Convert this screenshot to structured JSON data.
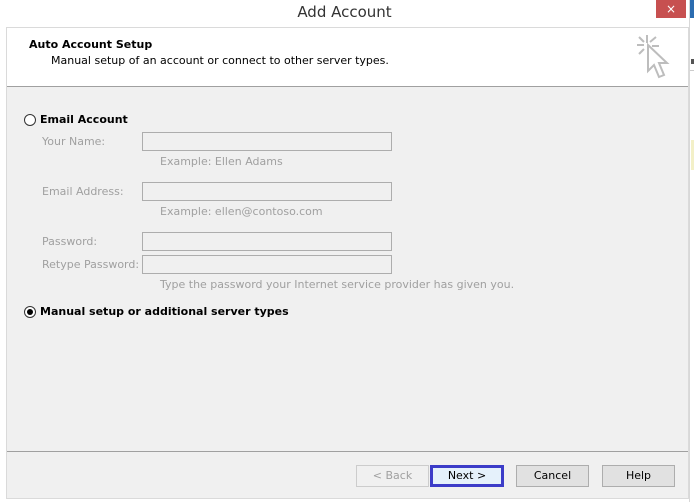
{
  "window": {
    "title": "Add Account",
    "close_label": "×"
  },
  "header": {
    "title": "Auto Account Setup",
    "subtitle": "Manual setup of an account or connect to other server types.",
    "icon": "cursor-click-icon"
  },
  "options": {
    "email_account": {
      "label": "Email Account",
      "checked": false
    },
    "manual_setup": {
      "label": "Manual setup or additional server types",
      "checked": true
    }
  },
  "fields": {
    "your_name": {
      "label": "Your Name:",
      "value": "",
      "hint": "Example: Ellen Adams"
    },
    "email_address": {
      "label": "Email Address:",
      "value": "",
      "hint": "Example: ellen@contoso.com"
    },
    "password": {
      "label": "Password:",
      "value": ""
    },
    "retype_password": {
      "label": "Retype Password:",
      "value": "",
      "hint": "Type the password your Internet service provider has given you."
    }
  },
  "buttons": {
    "back": "< Back",
    "next": "Next >",
    "cancel": "Cancel",
    "help": "Help"
  },
  "colors": {
    "close_bg": "#c75050",
    "default_button_border": "#3c3cc8",
    "dialog_bg": "#f0f0f0"
  }
}
